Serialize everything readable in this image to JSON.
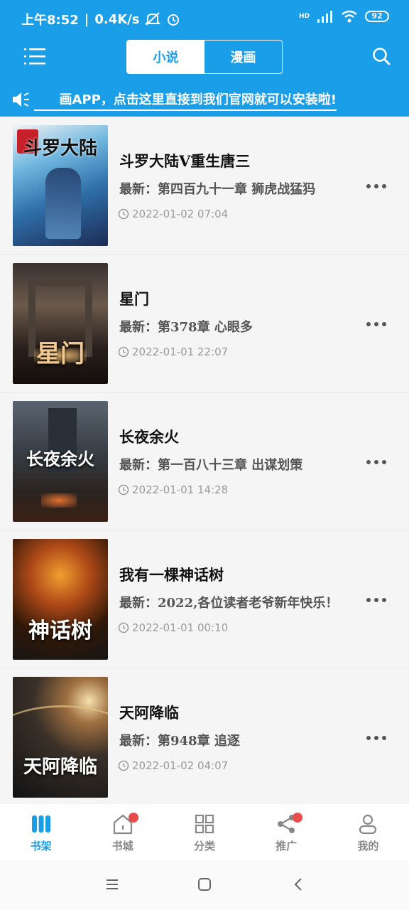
{
  "status": {
    "time": "上午8:52",
    "speed": "0.4K/s",
    "battery": "92",
    "net": "HD"
  },
  "top": {
    "tabs": [
      {
        "label": "小说"
      },
      {
        "label": "漫画"
      }
    ]
  },
  "notice": {
    "text": "画APP，点击这里直接到我们官网就可以安装啦!"
  },
  "books": [
    {
      "title": "斗罗大陆V重生唐三",
      "latest": "最新：第四百九十一章 狮虎战猛犸",
      "time": "2022-01-02 07:04",
      "cover_text": "斗罗大陆"
    },
    {
      "title": "星门",
      "latest": "最新：第378章 心眼多",
      "time": "2022-01-01 22:07",
      "cover_text": "星门"
    },
    {
      "title": "长夜余火",
      "latest": "最新：第一百八十三章 出谋划策",
      "time": "2022-01-01 14:28",
      "cover_text": "长夜余火"
    },
    {
      "title": "我有一棵神话树",
      "latest": "最新：2022,各位读者老爷新年快乐！",
      "time": "2022-01-01 00:10",
      "cover_text": "神话树"
    },
    {
      "title": "天阿降临",
      "latest": "最新：第948章 追逐",
      "time": "2022-01-02 04:07",
      "cover_text": "天阿降临"
    }
  ],
  "tabbar": [
    {
      "label": "书架"
    },
    {
      "label": "书城"
    },
    {
      "label": "分类"
    },
    {
      "label": "推广"
    },
    {
      "label": "我的"
    }
  ],
  "colors": {
    "accent": "#1a9ee8",
    "badge": "#e74c4c"
  }
}
